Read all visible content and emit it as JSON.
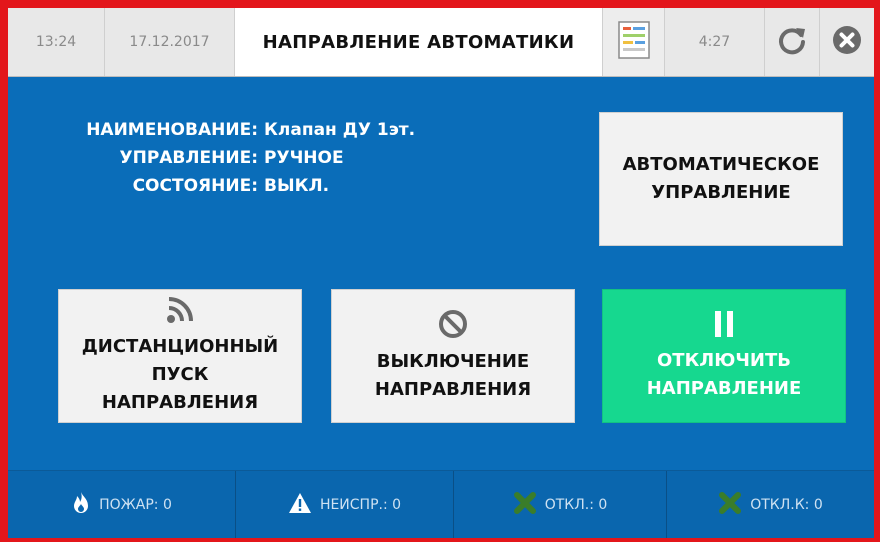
{
  "header": {
    "time": "13:24",
    "date": "17.12.2017",
    "title": "НАПРАВЛЕНИЕ АВТОМАТИКИ",
    "timer": "4:27",
    "icons": [
      "report-icon",
      "refresh-icon",
      "close-icon"
    ]
  },
  "info": {
    "name_label": "НАИМЕНОВАНИЕ:",
    "name_value": "Клапан ДУ 1эт.",
    "control_label": "УПРАВЛЕНИЕ:",
    "control_value": "РУЧНОЕ",
    "state_label": "СОСТОЯНИЕ:",
    "state_value": "ВЫКЛ."
  },
  "buttons": {
    "auto_line1": "АВТОМАТИЧЕСКОЕ",
    "auto_line2": "УПРАВЛЕНИЕ",
    "remote_line1": "ДИСТАНЦИОННЫЙ",
    "remote_line2": "ПУСК",
    "remote_line3": "НАПРАВЛЕНИЯ",
    "disable_line1": "ВЫКЛЮЧЕНИЕ",
    "disable_line2": "НАПРАВЛЕНИЯ",
    "off_line1": "ОТКЛЮЧИТЬ",
    "off_line2": "НАПРАВЛЕНИЕ"
  },
  "footer": {
    "fire": "ПОЖАР: 0",
    "fault": "НЕИСПР.: 0",
    "off": "ОТКЛ.: 0",
    "off_k": "ОТКЛ.К: 0"
  },
  "colors": {
    "background": "#0a6db9",
    "border": "#e3161b",
    "green_button": "#16d88f"
  }
}
